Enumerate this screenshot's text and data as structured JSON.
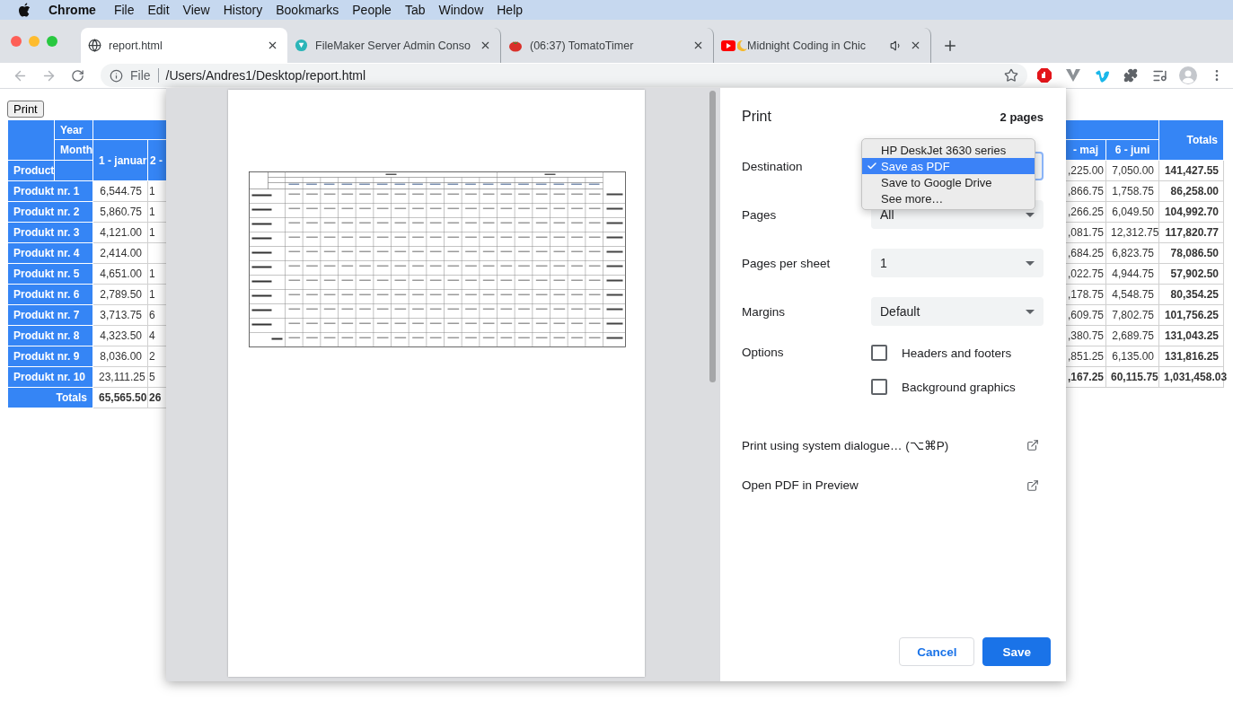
{
  "menubar": {
    "items": [
      {
        "label": "Chrome",
        "app": true
      },
      {
        "label": "File",
        "app": false
      },
      {
        "label": "Edit",
        "app": false
      },
      {
        "label": "View",
        "app": false
      },
      {
        "label": "History",
        "app": false
      },
      {
        "label": "Bookmarks",
        "app": false
      },
      {
        "label": "People",
        "app": false
      },
      {
        "label": "Tab",
        "app": false
      },
      {
        "label": "Window",
        "app": false
      },
      {
        "label": "Help",
        "app": false
      }
    ]
  },
  "tabs": [
    {
      "title": "report.html",
      "selected": true,
      "audio_playing": false
    },
    {
      "title": "FileMaker Server Admin Conso",
      "selected": false,
      "audio_playing": false
    },
    {
      "title": "(06:37) TomatoTimer",
      "selected": false,
      "audio_playing": false
    },
    {
      "title": "Midnight Coding in Chic",
      "selected": false,
      "audio_playing": true
    }
  ],
  "address_bar": {
    "scheme": "File",
    "url": "/Users/Andres1/Desktop/report.html"
  },
  "page": {
    "print_button": "Print",
    "left_table": {
      "year": "Year",
      "month": "Month",
      "product": "Product",
      "columns": [
        "1 - januar",
        "2 -"
      ],
      "rows": [
        {
          "product": "Produkt nr. 1",
          "values": [
            "6,544.75",
            "1"
          ]
        },
        {
          "product": "Produkt nr. 2",
          "values": [
            "5,860.75",
            "1"
          ]
        },
        {
          "product": "Produkt nr. 3",
          "values": [
            "4,121.00",
            "1"
          ]
        },
        {
          "product": "Produkt nr. 4",
          "values": [
            "2,414.00"
          ]
        },
        {
          "product": "Produkt nr. 5",
          "values": [
            "4,651.00",
            "1"
          ]
        },
        {
          "product": "Produkt nr. 6",
          "values": [
            "2,789.50",
            "1"
          ]
        },
        {
          "product": "Produkt nr. 7",
          "values": [
            "3,713.75",
            "6"
          ]
        },
        {
          "product": "Produkt nr. 8",
          "values": [
            "4,323.50",
            "4"
          ]
        },
        {
          "product": "Produkt nr. 9",
          "values": [
            "8,036.00",
            "2"
          ]
        },
        {
          "product": "Produkt nr. 10",
          "values": [
            "23,111.25",
            "5"
          ]
        }
      ],
      "totals": {
        "label": "Totals",
        "values": [
          "65,565.50",
          "26"
        ]
      }
    },
    "right_table": {
      "columns": [
        "- maj",
        "6 - juni"
      ],
      "totals_header": "Totals",
      "rows": [
        {
          "values": [
            ",225.00",
            "7,050.00",
            "141,427.55"
          ]
        },
        {
          "values": [
            ",866.75",
            "1,758.75",
            "86,258.00"
          ]
        },
        {
          "values": [
            ",266.25",
            "6,049.50",
            "104,992.70"
          ]
        },
        {
          "values": [
            ",081.75",
            "12,312.75",
            "117,820.77"
          ]
        },
        {
          "values": [
            ",684.25",
            "6,823.75",
            "78,086.50"
          ]
        },
        {
          "values": [
            ",022.75",
            "4,944.75",
            "57,902.50"
          ]
        },
        {
          "values": [
            ",178.75",
            "4,548.75",
            "80,354.25"
          ]
        },
        {
          "values": [
            ",609.75",
            "7,802.75",
            "101,756.25"
          ]
        },
        {
          "values": [
            ",380.75",
            "2,689.75",
            "131,043.25"
          ]
        },
        {
          "values": [
            ",851.25",
            "6,135.00",
            "131,816.25"
          ]
        }
      ],
      "totals": {
        "values": [
          ",167.25",
          "60,115.75",
          "1,031,458.03"
        ]
      }
    }
  },
  "print_dialog": {
    "title": "Print",
    "page_count": "2 pages",
    "settings": [
      {
        "label": "Destination",
        "kind": "select"
      },
      {
        "label": "Pages",
        "kind": "select",
        "value": "All"
      },
      {
        "label": "Pages per sheet",
        "kind": "select",
        "value": "1"
      },
      {
        "label": "Margins",
        "kind": "select",
        "value": "Default"
      }
    ],
    "options_label": "Options",
    "options": [
      {
        "label": "Headers and footers",
        "checked": false
      },
      {
        "label": "Background graphics",
        "checked": false
      }
    ],
    "links": [
      "Print using system dialogue… (⌥⌘P)",
      "Open PDF in Preview"
    ],
    "destination_menu": [
      {
        "label": "HP DeskJet 3630 series",
        "selected": false
      },
      {
        "label": "Save as PDF",
        "selected": true
      },
      {
        "label": "Save to Google Drive",
        "selected": false
      },
      {
        "label": "See more…",
        "selected": false
      }
    ],
    "buttons": {
      "cancel": "Cancel",
      "save": "Save"
    }
  }
}
